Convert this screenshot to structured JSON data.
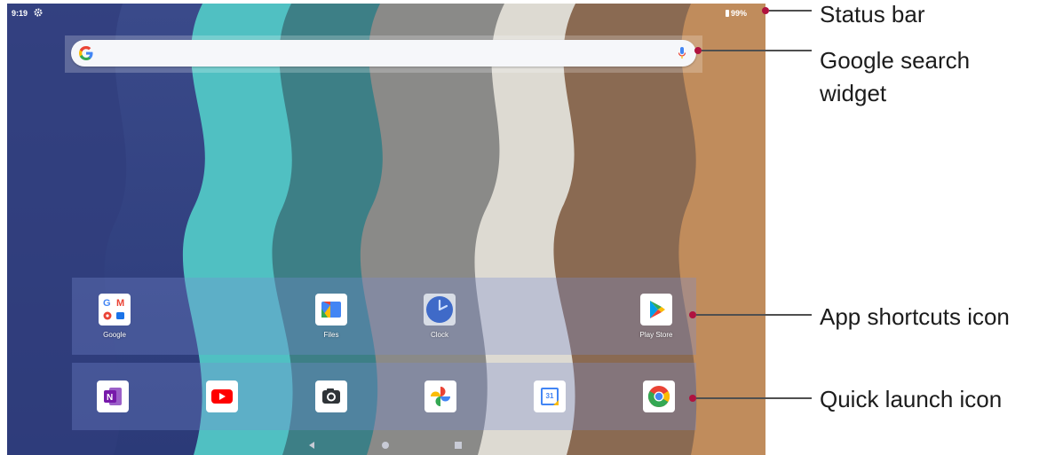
{
  "status_bar": {
    "time": "9:19",
    "battery": "99%"
  },
  "shortcut_apps": [
    {
      "label": "Google",
      "icon": "google-folder-icon"
    },
    {
      "label": "Files",
      "icon": "files-icon"
    },
    {
      "label": "Clock",
      "icon": "clock-icon"
    },
    {
      "label": "Play Store",
      "icon": "play-store-icon"
    }
  ],
  "quick_launch_apps": [
    "onenote-icon",
    "youtube-icon",
    "camera-icon",
    "photos-icon",
    "calendar-icon",
    "chrome-icon"
  ],
  "calendar_day": "31",
  "annotations": {
    "status_bar": "Status bar",
    "search_widget_line1": "Google search",
    "search_widget_line2": "widget",
    "app_shortcuts": "App shortcuts icon",
    "quick_launch": "Quick launch icon"
  },
  "colors": {
    "accent": "#b0123f",
    "leader_line": "#4f4f4f"
  }
}
